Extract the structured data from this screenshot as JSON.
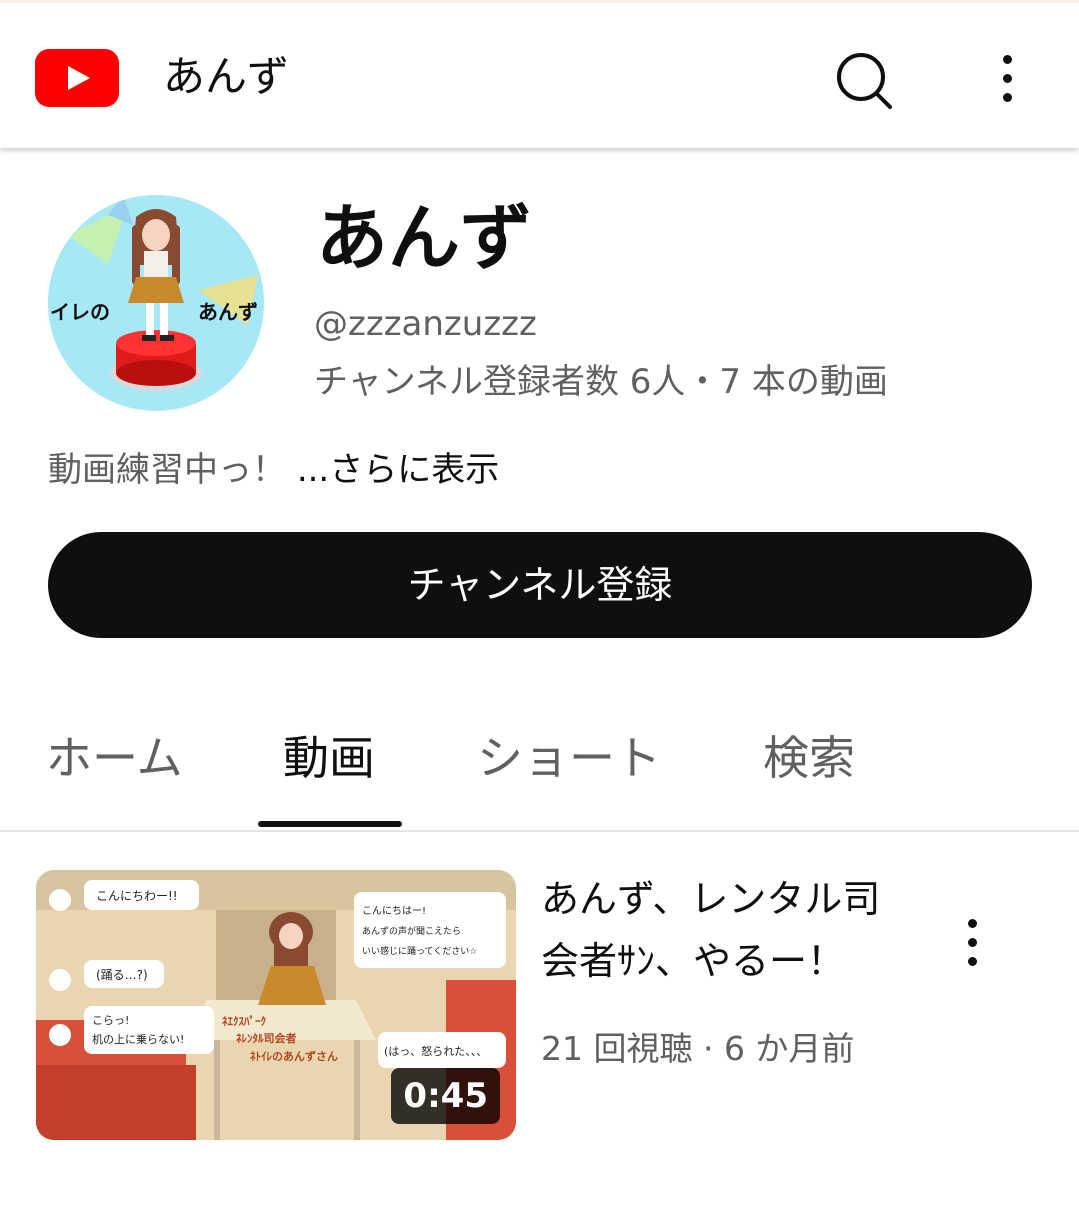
{
  "header": {
    "title": "あんず",
    "logo_icon": "youtube-logo-icon",
    "search_icon": "search-icon",
    "more_icon": "more-vert-icon",
    "brand_color": "#ff0000"
  },
  "channel": {
    "name": "あんず",
    "handle": "@zzzanzuzzz",
    "stats": "チャンネル登録者数 6人・7 本の動画",
    "description": "動画練習中っ！",
    "more_link": "...さらに表示",
    "subscribe_label": "チャンネル登録",
    "avatar_text_left": "イレの",
    "avatar_text_right": "あんず"
  },
  "tabs": [
    {
      "label": "ホーム",
      "active": false
    },
    {
      "label": "動画",
      "active": true
    },
    {
      "label": "ショート",
      "active": false
    },
    {
      "label": "検索",
      "active": false
    }
  ],
  "videos": [
    {
      "title": "あんず、レンタル司会者ｻﾝ、やるー！",
      "meta": "21 回視聴 · 6 か月前",
      "duration": "0:45",
      "thumb_captions": [
        "こんにちわー!!",
        "(踊る…?)",
        "こらっ!",
        "机の上に乗らない!",
        "こんにちはー!",
        "あんずの声が聞こえたら",
        "いい感じに踊ってください☆",
        "(はっ、怒られた、、、",
        "ﾈｴｸｽﾊﾟｰｸ",
        "ﾈﾚﾝﾀﾙ司会者",
        "ﾈﾄｲﾚのあんずさん"
      ]
    }
  ]
}
